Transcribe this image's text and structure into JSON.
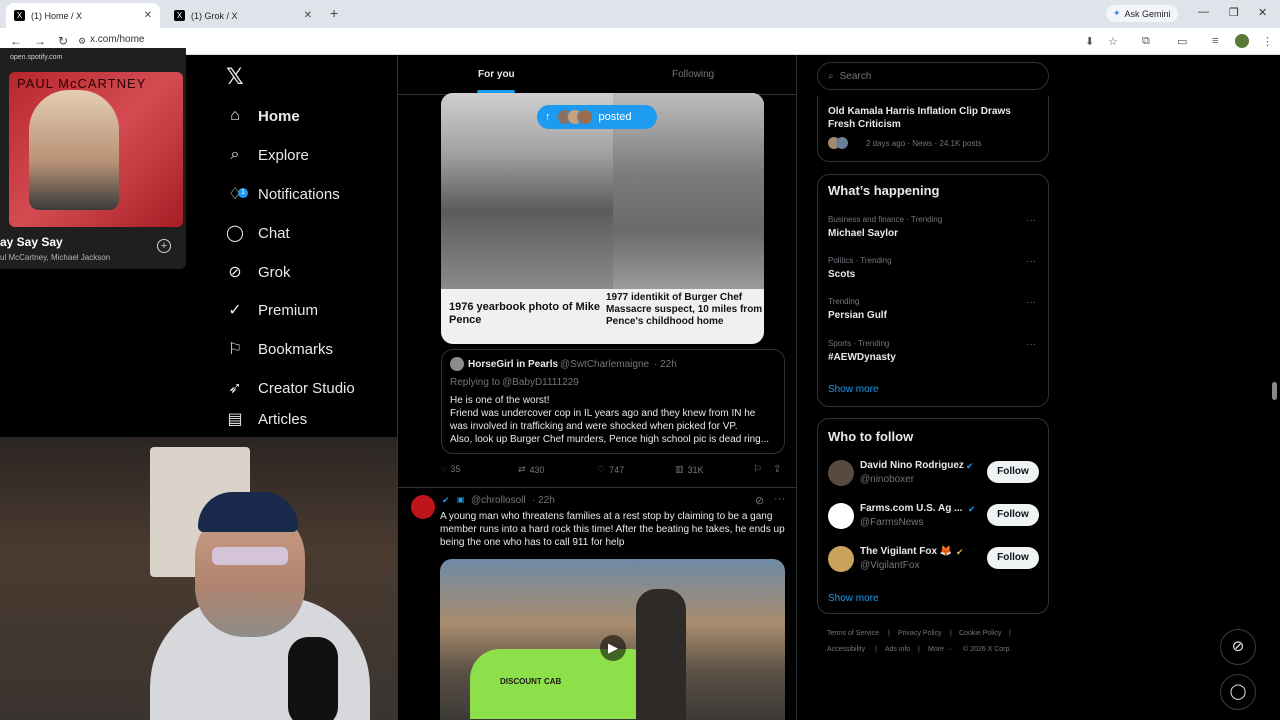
{
  "browser": {
    "tabs": [
      {
        "title": "(1) Home / X",
        "active": true
      },
      {
        "title": "(1) Grok / X",
        "active": false
      }
    ],
    "new_tab": "+",
    "url": "x.com/home",
    "ask_gemini": "Ask Gemini"
  },
  "spotify": {
    "source": "open.spotify.com",
    "album_text": "PAUL McCARTNEY",
    "song": "ay Say Say",
    "artist": "ul McCartney, Michael Jackson"
  },
  "nav": {
    "items": [
      {
        "label": "Home",
        "icon": "home-icon"
      },
      {
        "label": "Explore",
        "icon": "search-icon"
      },
      {
        "label": "Notifications",
        "icon": "bell-icon",
        "badge": "1"
      },
      {
        "label": "Chat",
        "icon": "chat-icon"
      },
      {
        "label": "Grok",
        "icon": "grok-icon"
      },
      {
        "label": "Premium",
        "icon": "premium-icon"
      },
      {
        "label": "Bookmarks",
        "icon": "bookmark-icon"
      },
      {
        "label": "Creator Studio",
        "icon": "rocket-icon"
      },
      {
        "label": "Articles",
        "icon": "article-icon"
      }
    ]
  },
  "feed": {
    "tabs": [
      "For you",
      "Following"
    ],
    "posted_pill": "posted",
    "image_captions": {
      "left": "1976 yearbook photo of Mike Pence",
      "right": "1977 identikit of Burger Chef Massacre suspect, 10 miles from Pence's childhood home"
    },
    "quote": {
      "name": "HorseGirl in Pearls",
      "handle": "@SwtCharlemaigne",
      "time": "· 22h",
      "replying_prefix": "Replying to",
      "replying_to": "@BabyD1111229",
      "lines": [
        "He is one of the worst!",
        "Friend was undercover cop in IL years ago and they knew from IN he",
        "was involved in trafficking and were shocked when picked for VP.",
        "Also, look up Burger Chef murders, Pence high school pic is dead ring..."
      ]
    },
    "actions": {
      "replies": "35",
      "reposts": "430",
      "likes": "747",
      "views": "31K"
    },
    "post2": {
      "handle": "@chrollosoll",
      "time": "· 22h",
      "text": "A young man who threatens families at a rest stop by claiming to be a gang member runs into a hard rock this time! After the beating he takes, he ends up being the one who has to call 911 for help",
      "video_sign": "DISCOUNT CAB"
    }
  },
  "right": {
    "search_placeholder": "Search",
    "top_story": {
      "title": "Old Kamala Harris Inflation Clip Draws Fresh Criticism",
      "meta": "2 days ago · News · 24.1K posts"
    },
    "whats_happening": {
      "title": "What’s happening",
      "trends": [
        {
          "category": "Business and finance · Trending",
          "name": "Michael Saylor"
        },
        {
          "category": "Politics · Trending",
          "name": "Scots"
        },
        {
          "category": "Trending",
          "name": "Persian Gulf"
        },
        {
          "category": "Sports · Trending",
          "name": "#AEWDynasty"
        }
      ],
      "show_more": "Show more"
    },
    "who_to_follow": {
      "title": "Who to follow",
      "accounts": [
        {
          "name": "David Nino Rodriguez",
          "handle": "@ninoboxer",
          "avatar_color": "#5a4a3e"
        },
        {
          "name": "Farms.com U.S. Ag ...",
          "handle": "@FarmsNews",
          "avatar_color": "#ffffff"
        },
        {
          "name": "The Vigilant Fox 🦊",
          "handle": "@VigilantFox",
          "avatar_color": "#c9a25c"
        }
      ],
      "follow_label": "Follow",
      "show_more": "Show more"
    },
    "footer": [
      "Terms of Service",
      "|",
      "Privacy Policy",
      "|",
      "Cookie Policy",
      "|",
      "Accessibility",
      "|",
      "Ads info",
      "|",
      "More ···",
      "© 2026 X Corp."
    ]
  },
  "colors": {
    "accent": "#1d9bf0",
    "background": "#000000",
    "border": "#2f3336"
  }
}
